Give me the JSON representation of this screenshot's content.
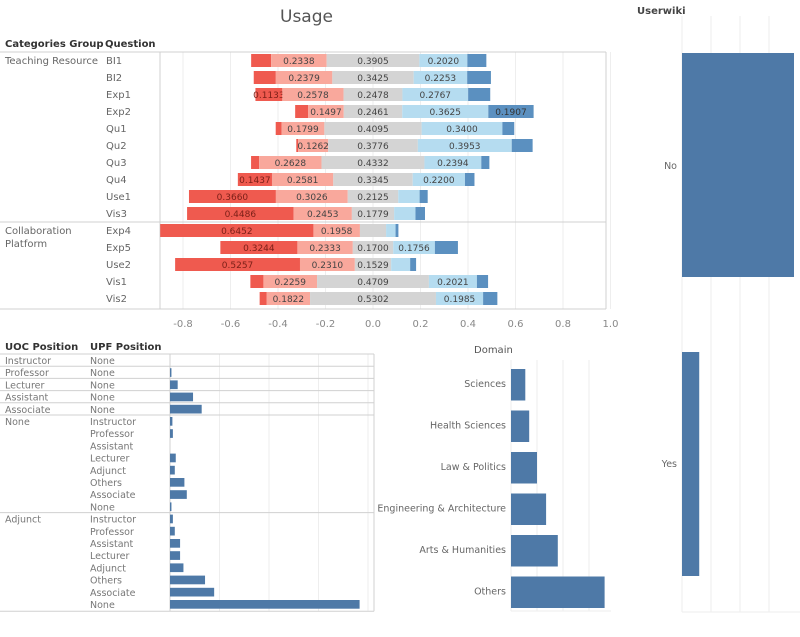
{
  "dashboard": {
    "usage_title": "Usage",
    "usage_headers": {
      "group": "Categories Group",
      "question": "Question"
    },
    "position_headers": {
      "uoc": "UOC Position",
      "upf": "UPF Position"
    },
    "domain_title": "Domain",
    "userwiki_title": "Userwiki"
  },
  "colors": {
    "strong_negative": "#ef5a4f",
    "negative": "#f9a89c",
    "neutral": "#d4d4d4",
    "positive": "#b5dcf0",
    "strong_positive": "#5b90c0",
    "bar": "#4e79a7",
    "grid": "#eeeeee",
    "divider": "#d0d0d0"
  },
  "chart_data": [
    {
      "type": "bar",
      "subtype": "diverging-stacked",
      "title": "Usage",
      "xlim": [
        -0.9,
        1.0
      ],
      "xticks": [
        "-0.8",
        "-0.6",
        "-0.4",
        "-0.2",
        "0.0",
        "0.2",
        "0.4",
        "0.6",
        "0.8",
        "1.0"
      ],
      "xtick_values": [
        -0.8,
        -0.6,
        -0.4,
        -0.2,
        0.0,
        0.2,
        0.4,
        0.6,
        0.8,
        1.0
      ],
      "segments": [
        "strong_negative",
        "negative",
        "neutral",
        "positive",
        "strong_positive"
      ],
      "groups": [
        {
          "name": "Teaching Resource",
          "rows": [
            {
              "question": "BI1",
              "values": [
                0.084,
                0.2338,
                0.3905,
                0.202,
                0.08
              ],
              "labels": [
                "",
                "0.2338",
                "0.3905",
                "0.2020",
                ""
              ]
            },
            {
              "question": "BI2",
              "values": [
                0.093,
                0.2379,
                0.3425,
                0.2253,
                0.1
              ],
              "labels": [
                "",
                "0.2379",
                "0.3425",
                "0.2253",
                ""
              ]
            },
            {
              "question": "Exp1",
              "values": [
                0.1133,
                0.2578,
                0.2478,
                0.2767,
                0.093
              ],
              "labels": [
                "0.1133",
                "0.2578",
                "0.2478",
                "0.2767",
                ""
              ]
            },
            {
              "question": "Exp2",
              "values": [
                0.055,
                0.1497,
                0.2461,
                0.3625,
                0.1907
              ],
              "labels": [
                "",
                "0.1497",
                "0.2461",
                "0.3625",
                "0.1907"
              ]
            },
            {
              "question": "Qu1",
              "values": [
                0.025,
                0.1799,
                0.4095,
                0.34,
                0.05
              ],
              "labels": [
                "",
                "0.1799",
                "0.4095",
                "0.3400",
                ""
              ]
            },
            {
              "question": "Qu2",
              "values": [
                0.008,
                0.1262,
                0.3776,
                0.3953,
                0.088
              ],
              "labels": [
                "",
                "0.1262",
                "0.3776",
                "0.3953",
                ""
              ]
            },
            {
              "question": "Qu3",
              "values": [
                0.034,
                0.2628,
                0.4332,
                0.2394,
                0.034
              ],
              "labels": [
                "",
                "0.2628",
                "0.4332",
                "0.2394",
                ""
              ]
            },
            {
              "question": "Qu4",
              "values": [
                0.1437,
                0.2581,
                0.3345,
                0.22,
                0.04
              ],
              "labels": [
                "0.1437",
                "0.2581",
                "0.3345",
                "0.2200",
                ""
              ]
            },
            {
              "question": "Use1",
              "values": [
                0.366,
                0.3026,
                0.2125,
                0.09,
                0.034
              ],
              "labels": [
                "0.3660",
                "0.3026",
                "0.2125",
                "",
                ""
              ]
            },
            {
              "question": "Vis3",
              "values": [
                0.4486,
                0.2453,
                0.1779,
                0.09,
                0.04
              ],
              "labels": [
                "0.4486",
                "0.2453",
                "0.1779",
                "",
                ""
              ]
            }
          ]
        },
        {
          "name": "Collaboration Platform",
          "rows": [
            {
              "question": "Exp4",
              "values": [
                0.6452,
                0.1958,
                0.11,
                0.04,
                0.012
              ],
              "labels": [
                "0.6452",
                "0.1958",
                "",
                "",
                ""
              ]
            },
            {
              "question": "Exp5",
              "values": [
                0.3244,
                0.2333,
                0.17,
                0.1756,
                0.097
              ],
              "labels": [
                "0.3244",
                "0.2333",
                "0.1700",
                "0.1756",
                ""
              ]
            },
            {
              "question": "Use2",
              "values": [
                0.5257,
                0.231,
                0.1529,
                0.08,
                0.025
              ],
              "labels": [
                "0.5257",
                "0.2310",
                "0.1529",
                "",
                ""
              ]
            },
            {
              "question": "Vis1",
              "values": [
                0.055,
                0.2259,
                0.4709,
                0.2021,
                0.047
              ],
              "labels": [
                "",
                "0.2259",
                "0.4709",
                "0.2021",
                ""
              ]
            },
            {
              "question": "Vis2",
              "values": [
                0.03,
                0.1822,
                0.5302,
                0.1985,
                0.06
              ],
              "labels": [
                "",
                "0.1822",
                "0.5302",
                "0.1985",
                ""
              ]
            }
          ]
        }
      ]
    },
    {
      "type": "bar",
      "subtype": "horizontal",
      "title": "",
      "xlim": [
        0,
        40
      ],
      "groups": [
        {
          "uoc": "Instructor",
          "rows": [
            {
              "upf": "None",
              "value": 0
            }
          ]
        },
        {
          "uoc": "Professor",
          "rows": [
            {
              "upf": "None",
              "value": 0.3
            }
          ]
        },
        {
          "uoc": "Lecturer",
          "rows": [
            {
              "upf": "None",
              "value": 1.6
            }
          ]
        },
        {
          "uoc": "Assistant",
          "rows": [
            {
              "upf": "None",
              "value": 4.8
            }
          ]
        },
        {
          "uoc": "Associate",
          "rows": [
            {
              "upf": "None",
              "value": 6.6
            }
          ]
        },
        {
          "uoc": "None",
          "rows": [
            {
              "upf": "Instructor",
              "value": 0.5
            },
            {
              "upf": "Professor",
              "value": 0.6
            },
            {
              "upf": "Assistant",
              "value": 0
            },
            {
              "upf": "Lecturer",
              "value": 1.2
            },
            {
              "upf": "Adjunct",
              "value": 1.0
            },
            {
              "upf": "Others",
              "value": 3.0
            },
            {
              "upf": "Associate",
              "value": 3.5
            },
            {
              "upf": "None",
              "value": 0.3
            }
          ]
        },
        {
          "uoc": "Adjunct",
          "rows": [
            {
              "upf": "Instructor",
              "value": 0.6
            },
            {
              "upf": "Professor",
              "value": 1.0
            },
            {
              "upf": "Assistant",
              "value": 2.1
            },
            {
              "upf": "Lecturer",
              "value": 2.1
            },
            {
              "upf": "Adjunct",
              "value": 2.8
            },
            {
              "upf": "Others",
              "value": 7.3
            },
            {
              "upf": "Associate",
              "value": 9.2
            },
            {
              "upf": "None",
              "value": 39.5
            }
          ]
        }
      ]
    },
    {
      "type": "bar",
      "subtype": "horizontal",
      "title": "Domain",
      "xlim": [
        0,
        40
      ],
      "categories": [
        "Sciences",
        "Health Sciences",
        "Law & Politics",
        "Engineering & Architecture",
        "Arts & Humanities",
        "Others"
      ],
      "values": [
        5.5,
        7.0,
        10.0,
        13.5,
        18.0,
        36.0
      ]
    },
    {
      "type": "bar",
      "subtype": "horizontal",
      "title": "Userwiki",
      "xlim": [
        0,
        120
      ],
      "categories": [
        "No",
        "Yes"
      ],
      "values": [
        117,
        18
      ]
    }
  ]
}
